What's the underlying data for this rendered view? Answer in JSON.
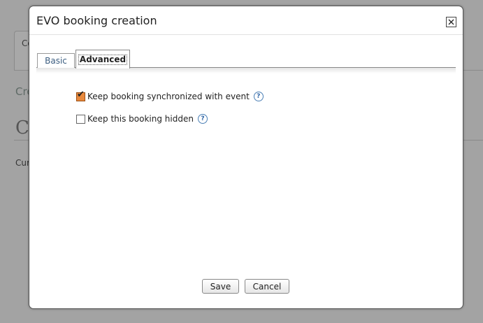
{
  "background": {
    "tab_label": "Co",
    "subtitle": "Cre",
    "heading": "C",
    "text": "Cur"
  },
  "dialog": {
    "title": "EVO booking creation",
    "close_icon": "close-icon",
    "tabs": [
      {
        "label": "Basic",
        "active": false
      },
      {
        "label": "Advanced",
        "active": true
      }
    ],
    "options": [
      {
        "label": "Keep booking synchronized with event",
        "checked": true,
        "help_icon": "help-icon"
      },
      {
        "label": "Keep this booking hidden",
        "checked": false,
        "help_icon": "help-icon"
      }
    ],
    "buttons": {
      "save": "Save",
      "cancel": "Cancel"
    },
    "colors": {
      "checkbox_checked": "#e8893d",
      "link_tab": "#3b5d80",
      "help_icon": "#2c63a5"
    }
  }
}
